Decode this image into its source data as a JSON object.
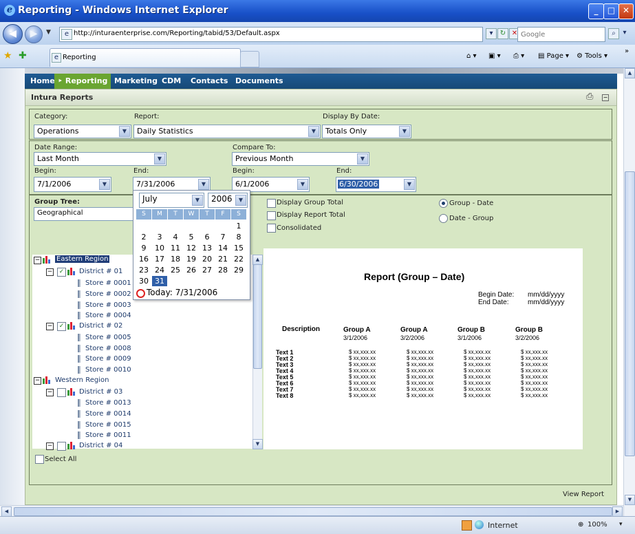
{
  "window": {
    "title": "Reporting - Windows Internet Explorer"
  },
  "address": {
    "url": "http://inturaenterprise.com/Reporting/tabid/53/Default.aspx",
    "search_placeholder": "Google"
  },
  "tabs": [
    {
      "label": "Reporting"
    }
  ],
  "commands": {
    "page": "Page",
    "tools": "Tools"
  },
  "nav": [
    "Home",
    "Reporting",
    "Marketing",
    "CDM",
    "Contacts",
    "Documents"
  ],
  "panel_title": "Intura Reports",
  "filters": {
    "category_label": "Category:",
    "category_value": "Operations",
    "report_label": "Report:",
    "report_value": "Daily Statistics",
    "display_label": "Display By Date:",
    "display_value": "Totals Only",
    "date_range_label": "Date Range:",
    "date_range_value": "Last Month",
    "compare_label": "Compare To:",
    "compare_value": "Previous Month",
    "begin_label": "Begin:",
    "begin_value": "7/1/2006",
    "end_label": "End:",
    "end_value": "7/31/2006",
    "cbegin_label": "Begin:",
    "cbegin_value": "6/1/2006",
    "cend_label": "End:",
    "cend_value": "6/30/2006"
  },
  "group_tree": {
    "label": "Group Tree:",
    "value": "Geographical"
  },
  "options": {
    "display_group_total": "Display Group Total",
    "display_report_total": "Display Report Total",
    "consolidated": "Consolidated",
    "group_date": "Group - Date",
    "date_group": "Date - Group"
  },
  "calendar": {
    "month": "July",
    "year": "2006",
    "dow": [
      "S",
      "M",
      "T",
      "W",
      "T",
      "F",
      "S"
    ],
    "days": [
      "1",
      "2",
      "3",
      "4",
      "5",
      "6",
      "7",
      "8",
      "9",
      "10",
      "11",
      "12",
      "13",
      "14",
      "15",
      "16",
      "17",
      "18",
      "19",
      "20",
      "21",
      "22",
      "23",
      "24",
      "25",
      "26",
      "27",
      "28",
      "29",
      "30",
      "31"
    ],
    "today": "Today: 7/31/2006"
  },
  "tree": {
    "eastern": "Eastern Region",
    "d01": "District # 01",
    "s0001": "Store # 0001",
    "s0002": "Store # 0002",
    "s0003": "Store # 0003",
    "s0004": "Store # 0004",
    "d02": "District # 02",
    "s0005": "Store # 0005",
    "s0008": "Store # 0008",
    "s0009": "Store # 0009",
    "s0010": "Store # 0010",
    "western": "Western Region",
    "d03": "District # 03",
    "s0013": "Store # 0013",
    "s0014": "Store # 0014",
    "s0015": "Store # 0015",
    "s0011": "Store # 0011",
    "d04": "District # 04"
  },
  "select_all": "Select All",
  "report": {
    "title": "Report (Group – Date)",
    "begin_label": "Begin Date:",
    "begin_value": "mm/dd/yyyy",
    "end_label": "End Date:",
    "end_value": "mm/dd/yyyy",
    "desc_header": "Description",
    "columns": [
      {
        "name": "Group A",
        "date": "3/1/2006"
      },
      {
        "name": "Group A",
        "date": "3/2/2006"
      },
      {
        "name": "Group B",
        "date": "3/1/2006"
      },
      {
        "name": "Group B",
        "date": "3/2/2006"
      }
    ],
    "rows": [
      "Text 1",
      "Text 2",
      "Text 3",
      "Text 4",
      "Text 5",
      "Text 6",
      "Text 7",
      "Text 8"
    ],
    "cell": "$ xx,xxx.xx"
  },
  "view_report": "View Report",
  "status": {
    "zone": "Internet",
    "zoom": "100%"
  }
}
